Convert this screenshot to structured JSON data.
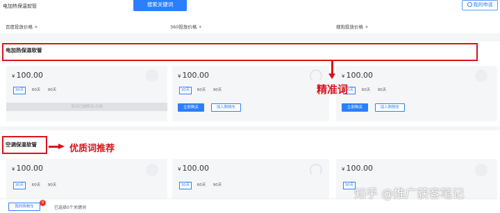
{
  "search": {
    "keyword": "电加热保温软管",
    "button_label": "搜索关键词"
  },
  "apply_button": "我的申请",
  "columns": [
    {
      "label": "百度投放价格"
    },
    {
      "label": "360投放价格"
    },
    {
      "label": "搜狗投放价格"
    }
  ],
  "sections": [
    {
      "title": "电加热保温软管",
      "annotation": "精准词",
      "cards": [
        {
          "price": "100.00",
          "currency": "¥",
          "durations": [
            "30天",
            "60天",
            "90天"
          ],
          "selected": "30天",
          "disabled_label": "该词已被购买/占用"
        },
        {
          "price": "100.00",
          "currency": "¥",
          "durations": [
            "30天",
            "60天",
            "90天"
          ],
          "selected": "30天",
          "buy_label": "立即购买",
          "cart_label": "加入购物车"
        },
        {
          "price": "100.00",
          "currency": "¥",
          "durations": [
            "30天",
            "60天",
            "90天"
          ],
          "selected": "30天",
          "buy_label": "立即购买",
          "cart_label": "加入购物车"
        }
      ]
    },
    {
      "title": "空调保温软管",
      "annotation": "优质词推荐",
      "cards": [
        {
          "price": "100.00",
          "currency": "¥",
          "durations": [
            "30天",
            "60天",
            "90天"
          ],
          "selected": "30天"
        },
        {
          "price": "100.00",
          "currency": "¥",
          "durations": [
            "30天",
            "60天",
            "90天"
          ],
          "selected": "30天"
        },
        {
          "price": "100.00",
          "currency": "¥",
          "durations": [
            "30天",
            "60天",
            "90天"
          ],
          "selected": "30天"
        }
      ]
    }
  ],
  "footer": {
    "cart_label": "我的购物车",
    "cart_count": "0",
    "selected_text": "已选择0个关键词"
  },
  "watermark": "知乎 @推广获客笔记",
  "colors": {
    "accent": "#2a7fff",
    "annotation": "#d9121a",
    "card_bg": "#f5f6f8"
  }
}
